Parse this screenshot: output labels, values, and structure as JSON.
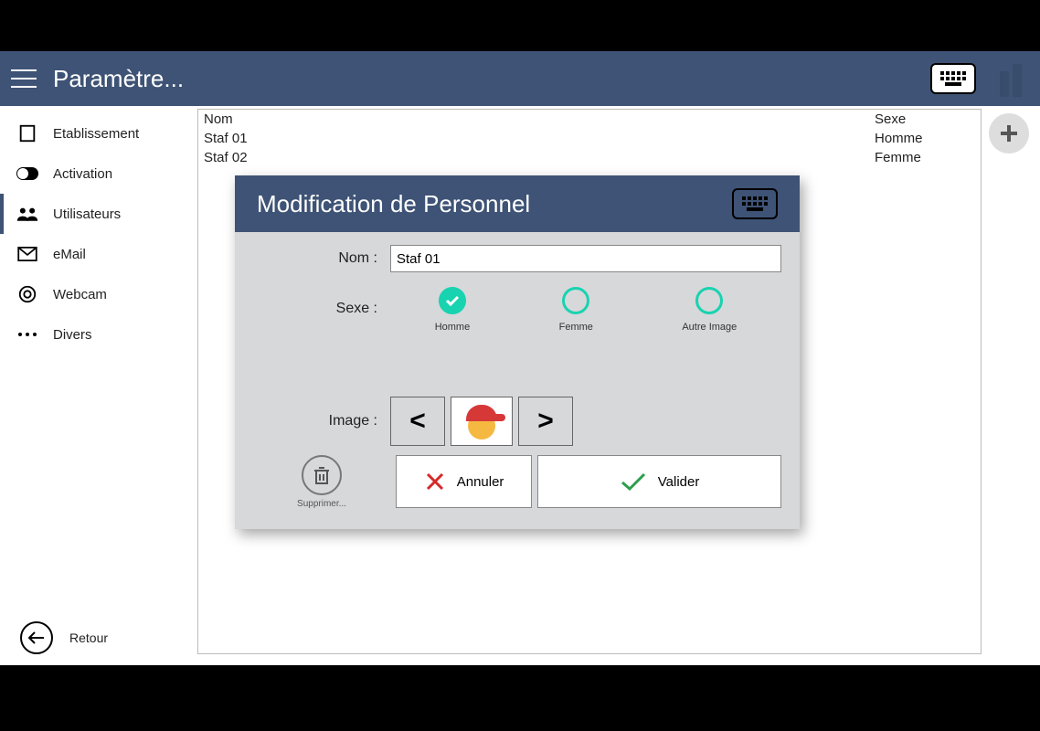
{
  "header": {
    "title": "Paramètre..."
  },
  "sidebar": {
    "items": [
      {
        "label": "Etablissement",
        "icon": "building"
      },
      {
        "label": "Activation",
        "icon": "toggle"
      },
      {
        "label": "Utilisateurs",
        "icon": "users",
        "active": true
      },
      {
        "label": "eMail",
        "icon": "mail"
      },
      {
        "label": "Webcam",
        "icon": "target"
      },
      {
        "label": "Divers",
        "icon": "dots"
      }
    ],
    "back": "Retour"
  },
  "table": {
    "headers": {
      "nom": "Nom",
      "sexe": "Sexe"
    },
    "rows": [
      {
        "nom": "Staf 01",
        "sexe": "Homme"
      },
      {
        "nom": "Staf 02",
        "sexe": "Femme"
      }
    ]
  },
  "modal": {
    "title": "Modification de Personnel",
    "nom_label": "Nom :",
    "nom_value": "Staf 01",
    "sexe_label": "Sexe :",
    "sex_options": [
      {
        "label": "Homme",
        "checked": true
      },
      {
        "label": "Femme",
        "checked": false
      },
      {
        "label": "Autre Image",
        "checked": false
      }
    ],
    "image_label": "Image :",
    "prev": "<",
    "next": ">",
    "delete": "Supprimer...",
    "cancel": "Annuler",
    "validate": "Valider"
  }
}
